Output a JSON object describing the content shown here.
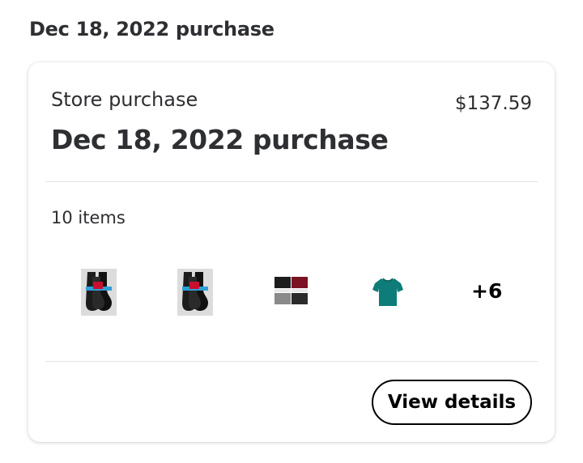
{
  "section_heading": "Dec 18, 2022 purchase",
  "card": {
    "store_label": "Store purchase",
    "price": "$137.59",
    "title": "Dec 18, 2022 purchase",
    "items_count": "10 items",
    "thumbnails": [
      {
        "icon": "socks-pack-icon"
      },
      {
        "icon": "socks-pack-icon"
      },
      {
        "icon": "underwear-pack-icon"
      },
      {
        "icon": "teal-tshirt-icon"
      }
    ],
    "more_count": "+6",
    "view_details_label": "View details"
  }
}
